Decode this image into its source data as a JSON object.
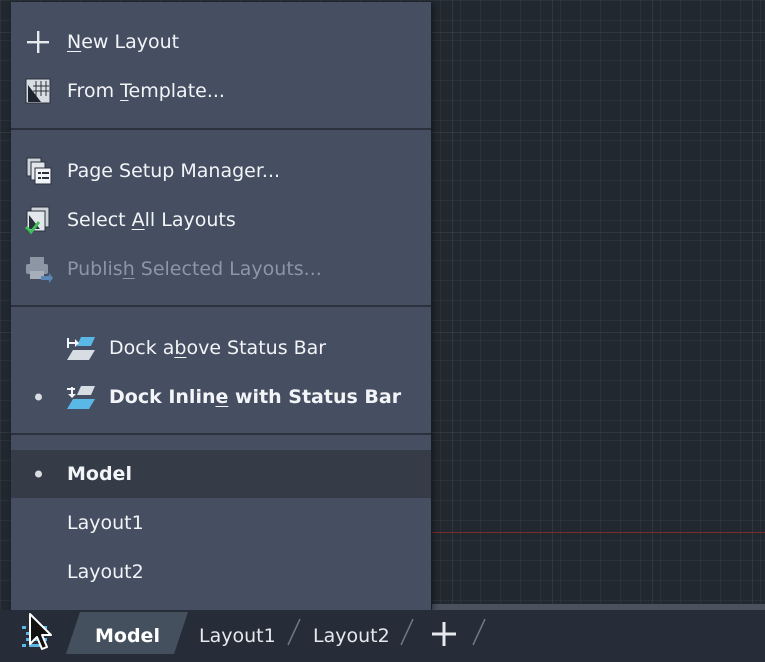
{
  "menu": {
    "section1": [
      {
        "pre": "",
        "u": "N",
        "post": "ew Layout",
        "icon": "plus-icon"
      },
      {
        "pre": "From ",
        "u": "T",
        "post": "emplate...",
        "icon": "template-icon"
      }
    ],
    "section2": [
      {
        "pre": "Page Setup Manager...",
        "u": "",
        "post": "",
        "icon": "page-setup-icon"
      },
      {
        "pre": "Select ",
        "u": "A",
        "post": "ll Layouts",
        "icon": "select-all-layouts-icon"
      },
      {
        "pre": "Publis",
        "u": "h",
        "post": " Selected Layouts...",
        "icon": "publish-icon",
        "disabled": true
      }
    ],
    "section3": [
      {
        "pre": "Dock a",
        "u": "b",
        "post": "ove Status Bar",
        "icon": "dock-above-icon",
        "checked": false
      },
      {
        "pre": "Dock Inlin",
        "u": "e",
        "post": " with Status Bar",
        "icon": "dock-inline-icon",
        "checked": true
      }
    ],
    "section4": [
      {
        "label": "Model",
        "checked": true,
        "selected": true
      },
      {
        "label": "Layout1",
        "checked": false
      },
      {
        "label": "Layout2",
        "checked": false
      }
    ]
  },
  "statusbar": {
    "tabs": [
      "Model",
      "Layout1",
      "Layout2"
    ],
    "active_tab": "Model",
    "layout_menu_icon": "layout-list-icon",
    "add_icon": "plus-icon"
  },
  "colors": {
    "menu_bg": "#454f61",
    "menu_selected_bg": "#353c48",
    "canvas_bg": "#212830",
    "accent_blue": "#59b8e6"
  }
}
